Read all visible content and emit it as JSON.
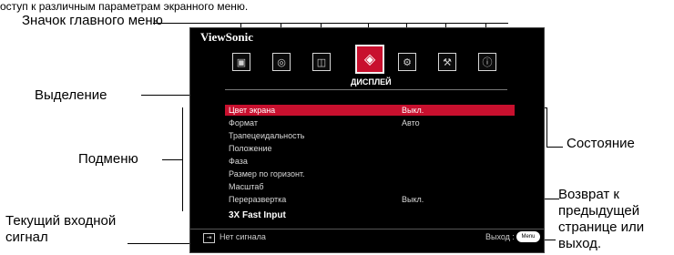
{
  "header_text": "оступ к различным параметрам экранного меню.",
  "osd": {
    "brand": "ViewSonic",
    "main_menu_label": "ДИСПЛЕЙ",
    "rows": [
      {
        "label": "Цвет экрана",
        "value": "Выкл.",
        "highlighted": true
      },
      {
        "label": "Формат",
        "value": "Авто",
        "highlighted": false
      },
      {
        "label": "Трапецеидальность",
        "value": "",
        "highlighted": false
      },
      {
        "label": "Положение",
        "value": "",
        "highlighted": false
      },
      {
        "label": "Фаза",
        "value": "",
        "highlighted": false
      },
      {
        "label": "Размер по горизонт.",
        "value": "",
        "highlighted": false
      },
      {
        "label": "Масштаб",
        "value": "",
        "highlighted": false
      },
      {
        "label": "Переразвертка",
        "value": "Выкл.",
        "highlighted": false
      }
    ],
    "fast_input": "3X Fast Input",
    "source_text": "Нет сигнала",
    "exit_label": "Выход :",
    "menu_button": "Menu",
    "icons": [
      "picture-icon",
      "audio-icon",
      "image-settings-icon",
      "display-icon",
      "settings-icon",
      "tools-icon",
      "info-icon"
    ],
    "selected_icon_index": 3,
    "accent": "#c8102e"
  },
  "callouts": {
    "main_menu_icon": "Значок главного меню",
    "highlight": "Выделение",
    "submenu": "Подменю",
    "current_input": "Текущий входной сигнал",
    "status": "Состояние",
    "back": "Возврат к предыдущей странице или выход."
  }
}
